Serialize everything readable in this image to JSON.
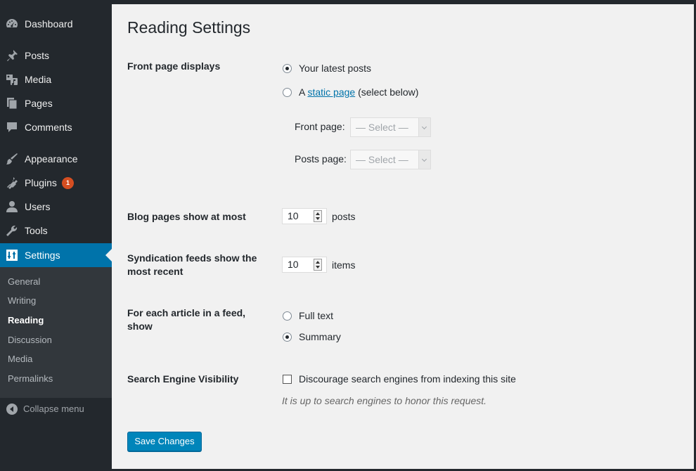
{
  "sidebar": {
    "items": [
      {
        "label": "Dashboard",
        "icon": "dashboard-icon"
      },
      {
        "label": "Posts",
        "icon": "pin-icon"
      },
      {
        "label": "Media",
        "icon": "media-icon"
      },
      {
        "label": "Pages",
        "icon": "pages-icon"
      },
      {
        "label": "Comments",
        "icon": "comment-icon"
      },
      {
        "label": "Appearance",
        "icon": "brush-icon"
      },
      {
        "label": "Plugins",
        "icon": "plug-icon",
        "badge": "1"
      },
      {
        "label": "Users",
        "icon": "user-icon"
      },
      {
        "label": "Tools",
        "icon": "wrench-icon"
      },
      {
        "label": "Settings",
        "icon": "settings-icon",
        "active": true
      }
    ],
    "submenu": [
      "General",
      "Writing",
      "Reading",
      "Discussion",
      "Media",
      "Permalinks"
    ],
    "current_submenu": "Reading",
    "collapse_label": "Collapse menu"
  },
  "page": {
    "title": "Reading Settings",
    "front_page": {
      "label": "Front page displays",
      "opt_latest": "Your latest posts",
      "opt_static_prefix": "A",
      "opt_static_link": "static page",
      "opt_static_suffix": "(select below)",
      "selected": "latest",
      "front_page_label": "Front page:",
      "posts_page_label": "Posts page:",
      "front_page_value": "— Select —",
      "posts_page_value": "— Select —"
    },
    "blog_pages": {
      "label": "Blog pages show at most",
      "value": "10",
      "unit": "posts"
    },
    "feeds": {
      "label": "Syndication feeds show the most recent",
      "value": "10",
      "unit": "items"
    },
    "article_feed": {
      "label": "For each article in a feed, show",
      "opt_full": "Full text",
      "opt_summary": "Summary",
      "selected": "summary"
    },
    "search": {
      "label": "Search Engine Visibility",
      "checkbox_label": "Discourage search engines from indexing this site",
      "checked": false,
      "hint": "It is up to search engines to honor this request."
    },
    "save_label": "Save Changes"
  },
  "colors": {
    "sidebar_bg": "#23282d",
    "active_bg": "#0073aa",
    "submenu_bg": "#32373c",
    "content_bg": "#f1f1f1",
    "button_bg": "#0085ba",
    "badge_bg": "#d54e21"
  }
}
